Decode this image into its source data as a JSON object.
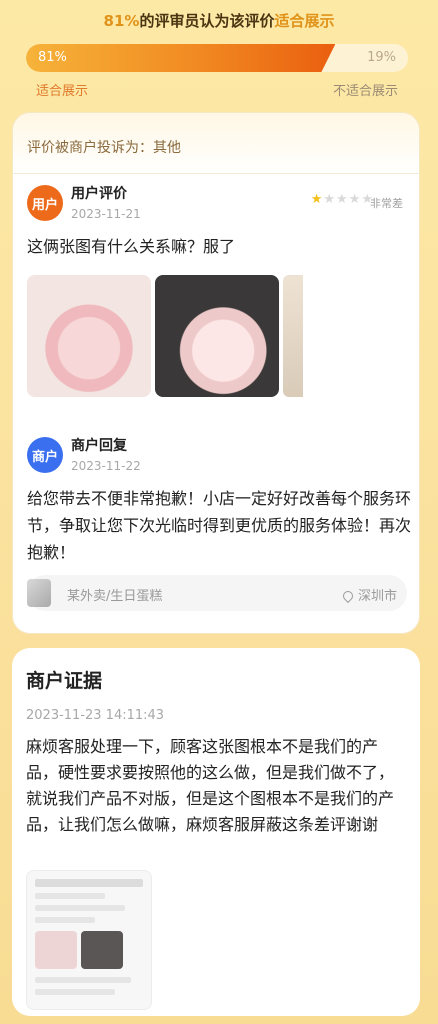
{
  "vote": {
    "headline_pct": "81%",
    "headline_mid": "的评审员认为该评价",
    "headline_hl": "适合展示",
    "left_pct": "81%",
    "right_pct": "19%",
    "left_fraction": 0.81,
    "left_label": "适合展示",
    "right_label": "不适合展示"
  },
  "complaint": "评价被商户投诉为：其他",
  "user_review": {
    "avatar": "用户",
    "title": "用户评价",
    "date": "2023-11-21",
    "rating": 1,
    "rating_max": 5,
    "rating_text": "非常差",
    "text": "这俩张图有什么关系嘛？服了"
  },
  "merchant_reply": {
    "avatar": "商户",
    "title": "商户回复",
    "date": "2023-11-22",
    "text": "给您带去不便非常抱歉！小店一定好好改善每个服务环节，争取让您下次光临时得到更优质的服务体验！再次抱歉！"
  },
  "shop": {
    "name": "某外卖/生日蛋糕",
    "city": "深圳市"
  },
  "evidence": {
    "title": "商户证据",
    "date": "2023-11-23 14:11:43",
    "text": "麻烦客服处理一下，顾客这张图根本不是我们的产品，硬性要求要按照他的这么做，但是我们做不了，就说我们产品不对版，但是这个图根本不是我们的产品，让我们怎么做嘛，麻烦客服屏蔽这条差评谢谢"
  },
  "colors": {
    "accent": "#f18a22",
    "user_avatar": "#ec6a1a",
    "merchant_avatar": "#3a6ff0",
    "star_on": "#f6c01b"
  }
}
